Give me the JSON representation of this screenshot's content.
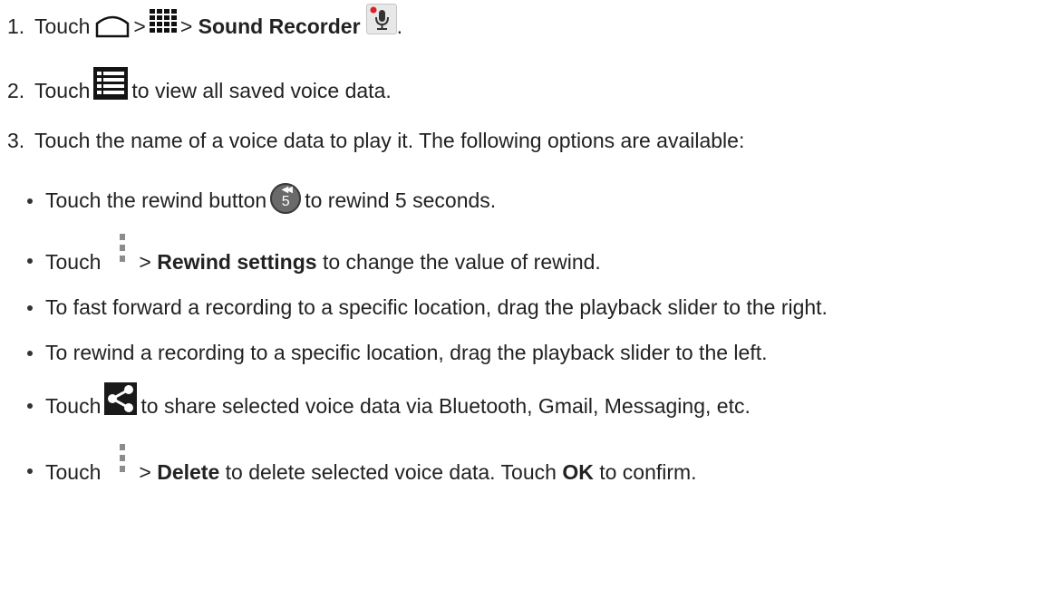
{
  "steps": [
    {
      "number": "1.",
      "prefix": "Touch",
      "sep1": ">",
      "sep2": ">",
      "app_name": "Sound Recorder",
      "suffix": "."
    },
    {
      "number": "2.",
      "prefix": "Touch",
      "rest": "to view all saved voice data."
    },
    {
      "number": "3.",
      "text": "Touch the name of a voice data to play it. The following options are available:"
    }
  ],
  "options": {
    "rewind": {
      "prefix": "Touch the rewind button",
      "rest": "to rewind 5 seconds.",
      "icon_digit": "5"
    },
    "rewind_settings": {
      "prefix": "Touch",
      "sep": ">",
      "bold": "Rewind settings",
      "rest": "to change the value of rewind."
    },
    "fast_forward": {
      "text": "To fast forward a recording to a specific location, drag the playback slider to the right."
    },
    "rewind_drag": {
      "text": "To rewind a recording to a specific location, drag the playback slider to the left."
    },
    "share": {
      "prefix": "Touch",
      "rest": "to share selected voice data via Bluetooth, Gmail, Messaging, etc."
    },
    "delete": {
      "prefix": "Touch",
      "sep": ">",
      "bold": "Delete",
      "rest": "to delete selected voice data. Touch",
      "ok": "OK",
      "end": "to confirm."
    }
  },
  "colors": {
    "text": "#222222",
    "icon_dark": "#1a1a1a",
    "menu_dots": "#8c8c8c",
    "record_dot": "#e02020"
  },
  "icons": [
    "home-icon",
    "apps-grid-icon",
    "sound-recorder-icon",
    "list-icon",
    "rewind-5-icon",
    "menu-icon",
    "share-icon"
  ]
}
